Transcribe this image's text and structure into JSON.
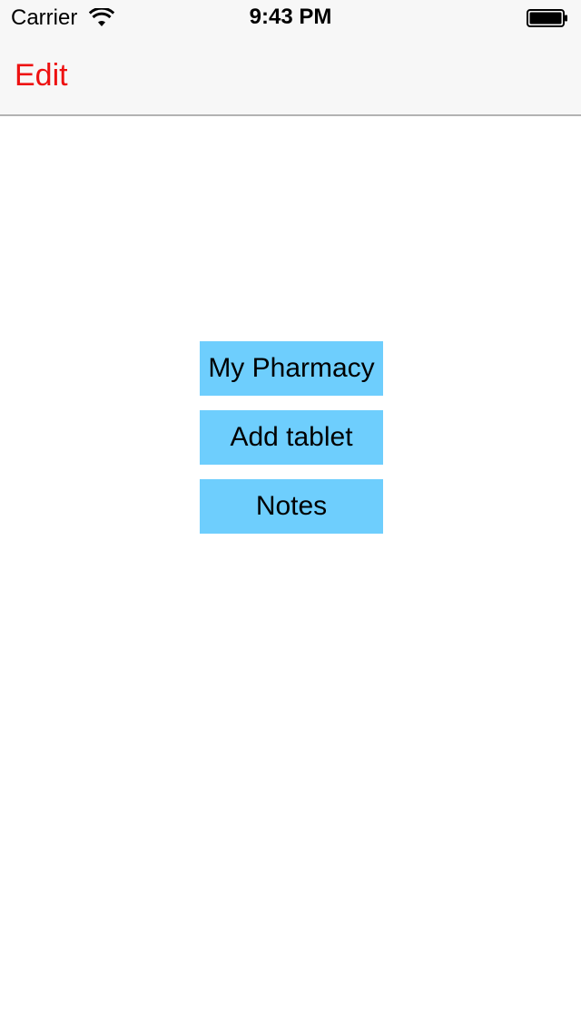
{
  "status_bar": {
    "carrier": "Carrier",
    "time": "9:43 PM",
    "wifi_icon": "wifi-icon",
    "battery_icon": "battery-icon"
  },
  "nav_bar": {
    "edit_label": "Edit",
    "accent_color": "#ee1111"
  },
  "menu": {
    "button_color": "#6ecefd",
    "buttons": [
      {
        "label": "My Pharmacy"
      },
      {
        "label": "Add tablet"
      },
      {
        "label": "Notes"
      }
    ]
  }
}
